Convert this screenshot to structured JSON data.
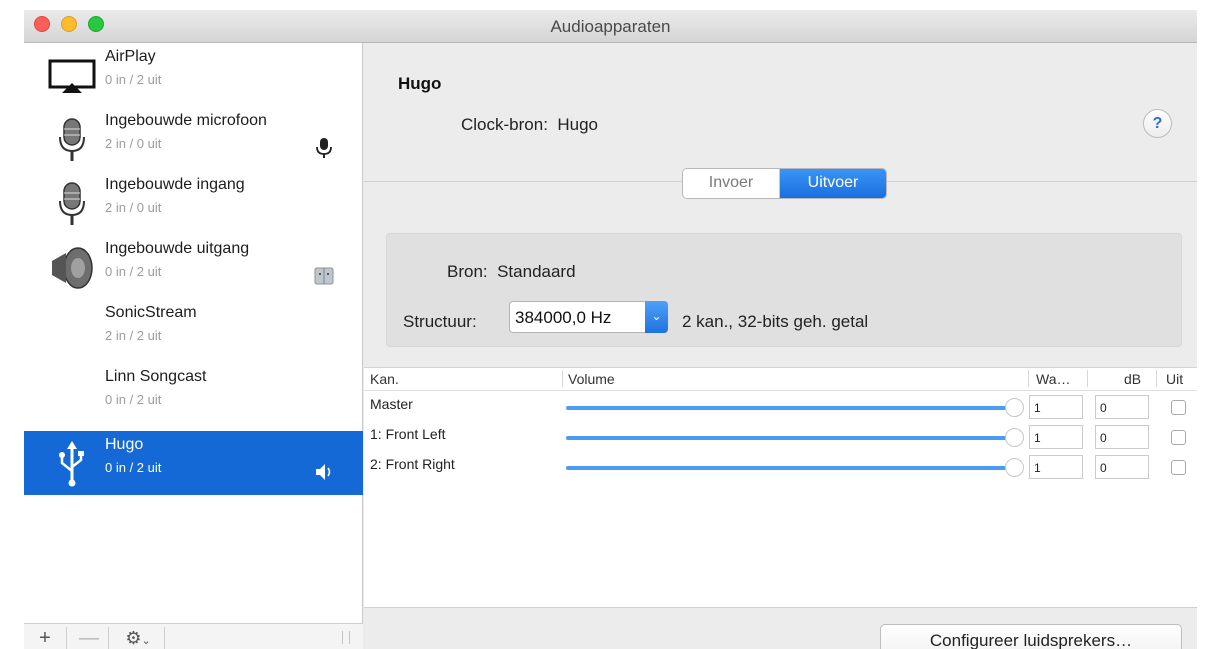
{
  "window": {
    "title": "Audioapparaten"
  },
  "devices": [
    {
      "name": "AirPlay",
      "io": "0 in / 2 uit",
      "icon": "airplay-icon"
    },
    {
      "name": "Ingebouwde microfoon",
      "io": "2 in / 0 uit",
      "icon": "microphone-icon",
      "badge": "microphone-input-icon"
    },
    {
      "name": "Ingebouwde ingang",
      "io": "2 in / 0 uit",
      "icon": "microphone-icon"
    },
    {
      "name": "Ingebouwde uitgang",
      "io": "0 in / 2 uit",
      "icon": "speaker-icon",
      "badge": "finder-icon"
    },
    {
      "name": "SonicStream",
      "io": "2 in / 2 uit"
    },
    {
      "name": "Linn Songcast",
      "io": "0 in / 2 uit"
    },
    {
      "name": "Hugo",
      "io": "0 in / 2 uit",
      "icon": "usb-icon",
      "badge": "speaker-output-icon",
      "selected": true
    }
  ],
  "sidebar_toolbar": {
    "add": "+",
    "remove": "—",
    "gear": "gear-icon"
  },
  "device": {
    "title": "Hugo",
    "clock_label": "Clock-bron:",
    "clock_value": "Hugo",
    "help": "?"
  },
  "tabs": {
    "input": "Invoer",
    "output": "Uitvoer",
    "active": "output"
  },
  "settings": {
    "source_label": "Bron:",
    "source_value": "Standaard",
    "format_label": "Structuur:",
    "format_value": "384000,0 Hz",
    "format_detail": "2 kan., 32-bits geh. getal"
  },
  "channels": {
    "headers": {
      "channel": "Kan.",
      "volume": "Volume",
      "value": "Wa…",
      "db": "dB",
      "mute": "Uit"
    },
    "rows": [
      {
        "label": "Master",
        "volume": 1.0,
        "value": "1",
        "db": "0",
        "mute": false
      },
      {
        "label": "1: Front Left",
        "volume": 1.0,
        "value": "1",
        "db": "0",
        "mute": false
      },
      {
        "label": "2: Front Right",
        "volume": 1.0,
        "value": "1",
        "db": "0",
        "mute": false
      }
    ]
  },
  "actions": {
    "configure_speakers": "Configureer luidsprekers…"
  },
  "colors": {
    "selection": "#1469d7",
    "accent": "#1a6fe0"
  }
}
